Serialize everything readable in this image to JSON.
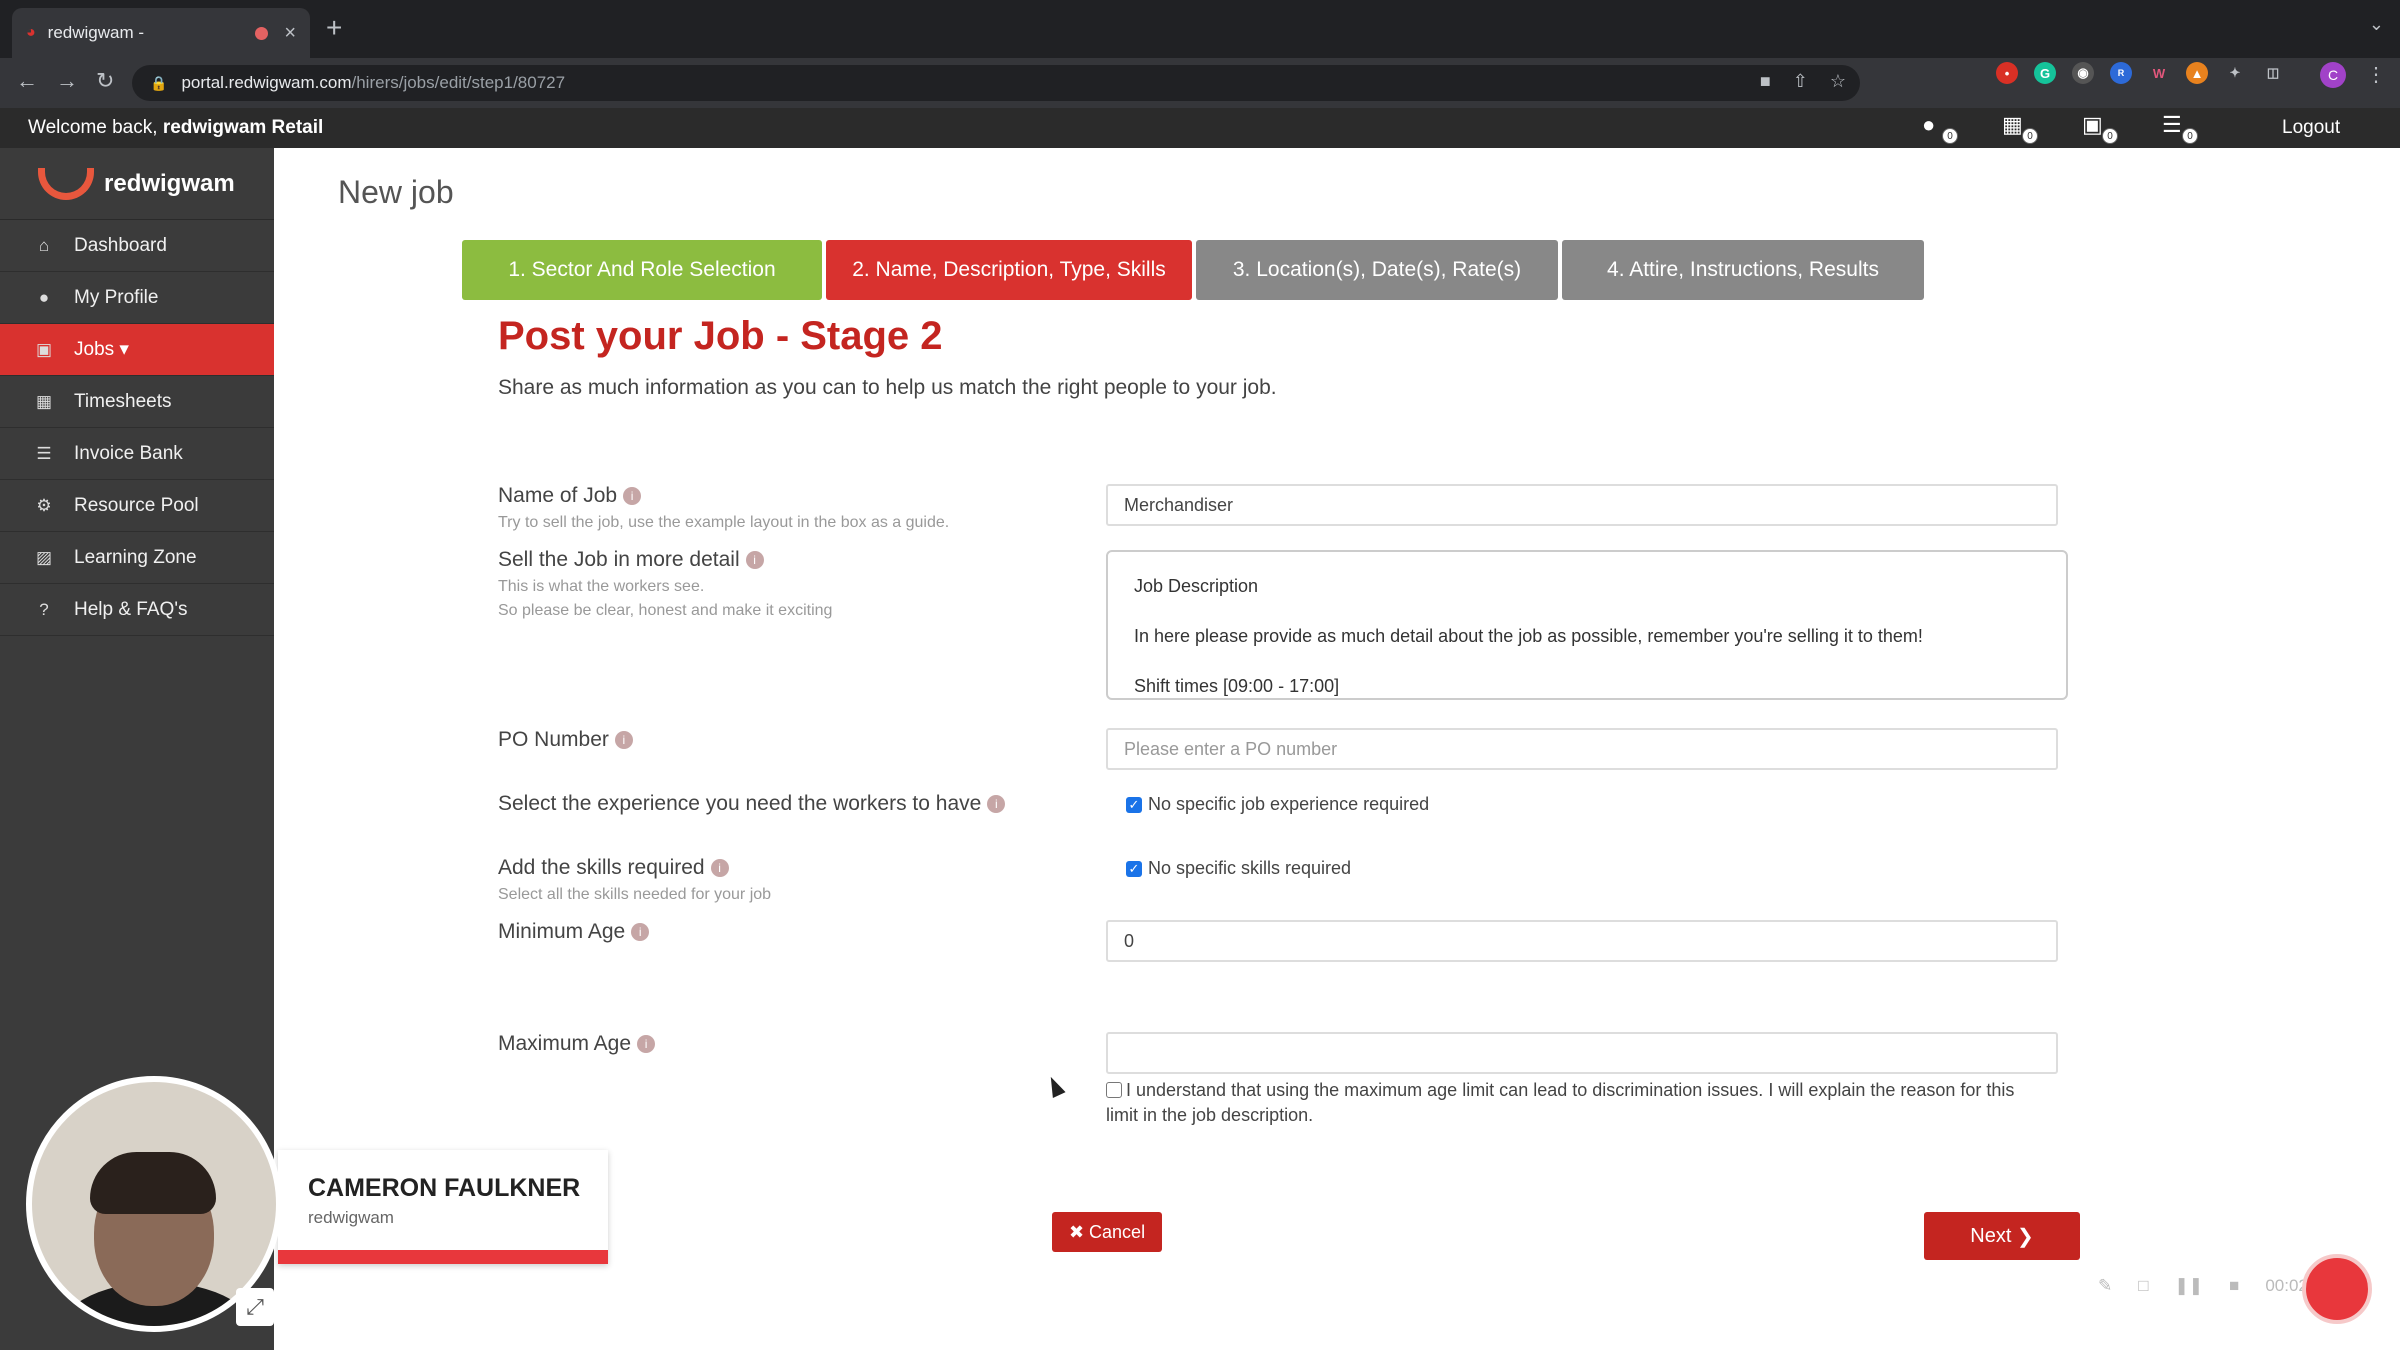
{
  "browser": {
    "tab_title": "redwigwam -",
    "url_domain": "portal.redwigwam.com",
    "url_path": "/hirers/jobs/edit/step1/80727"
  },
  "appbar": {
    "welcome_prefix": "Welcome back,",
    "welcome_name": "redwigwam Retail",
    "logout": "Logout",
    "icon_counts": [
      "0",
      "0",
      "0",
      "0"
    ]
  },
  "sidebar": {
    "brand": "redwigwam",
    "items": [
      {
        "label": "Dashboard",
        "icon": "home-icon"
      },
      {
        "label": "My Profile",
        "icon": "user-icon"
      },
      {
        "label": "Jobs ▾",
        "icon": "briefcase-icon",
        "active": true
      },
      {
        "label": "Timesheets",
        "icon": "calendar-icon"
      },
      {
        "label": "Invoice Bank",
        "icon": "list-icon"
      },
      {
        "label": "Resource Pool",
        "icon": "people-icon"
      },
      {
        "label": "Learning Zone",
        "icon": "book-icon"
      },
      {
        "label": "Help & FAQ's",
        "icon": "question-icon"
      }
    ]
  },
  "main": {
    "page_title": "New job",
    "steps": [
      "1. Sector And Role Selection",
      "2. Name, Description, Type, Skills",
      "3. Location(s), Date(s), Rate(s)",
      "4. Attire, Instructions, Results"
    ],
    "heading": "Post your Job - Stage 2",
    "subheading": "Share as much information as you can to help us match the right people to your job."
  },
  "form": {
    "job_name_label": "Name of Job",
    "job_name_help": "Try to sell the job, use the example layout in the box as a guide.",
    "job_name_value": "Merchandiser",
    "detail_label": "Sell the Job in more detail",
    "detail_help_1": "This is what the workers see.",
    "detail_help_2": "So please be clear, honest and make it exciting",
    "detail_line_1": "Job Description",
    "detail_line_2": "In here please provide as much detail about the job as possible, remember you're selling it to them!",
    "detail_line_3": "Shift times [09:00 - 17:00]",
    "po_label": "PO Number",
    "po_placeholder": "Please enter a PO number",
    "experience_label": "Select the experience you need the workers to have",
    "experience_check": "No specific job experience required",
    "skills_label": "Add the skills required",
    "skills_help": "Select all the skills needed for your job",
    "skills_check": "No specific skills required",
    "min_age_label": "Minimum Age",
    "min_age_value": "0",
    "max_age_label": "Maximum Age",
    "max_age_value": "",
    "agree_text": "I understand that using the maximum age limit can lead to discrimination issues. I will explain the reason for this limit in the job description.",
    "cancel_label": "Cancel",
    "next_label": "Next"
  },
  "overlay": {
    "presenter_name": "CAMERON FAULKNER",
    "presenter_org": "redwigwam",
    "rec_timer": "00:02"
  },
  "colors": {
    "brand_red": "#d9322f",
    "step_green": "#8cbc40",
    "step_grey": "#888888",
    "sidebar_bg": "#3b3b3b"
  }
}
